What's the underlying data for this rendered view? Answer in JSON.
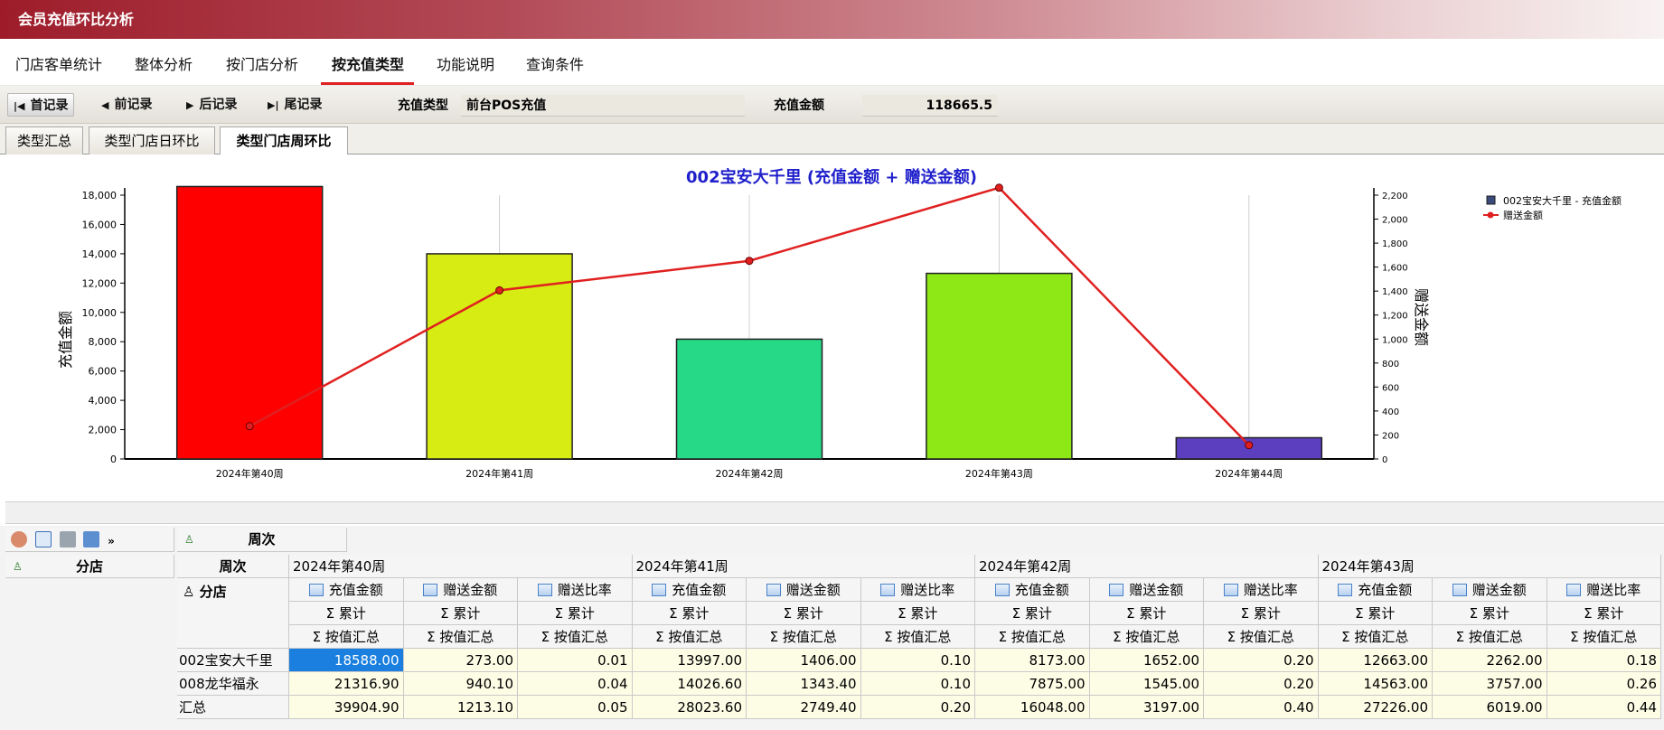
{
  "window": {
    "title": "会员充值环比分析"
  },
  "main_tabs": [
    {
      "label": "门店客单统计"
    },
    {
      "label": "整体分析"
    },
    {
      "label": "按门店分析"
    },
    {
      "label": "按充值类型",
      "active": true
    },
    {
      "label": "功能说明"
    },
    {
      "label": "查询条件"
    }
  ],
  "nav": {
    "first": "首记录",
    "prev": "前记录",
    "next": "后记录",
    "last": "尾记录"
  },
  "fields": {
    "recharge_type_label": "充值类型",
    "recharge_type_value": "前台POS充值",
    "recharge_amount_label": "充值金额",
    "recharge_amount_value": "118665.5"
  },
  "sub_tabs": [
    {
      "label": "类型汇总"
    },
    {
      "label": "类型门店日环比"
    },
    {
      "label": "类型门店周环比",
      "active": true
    }
  ],
  "chart_data": {
    "type": "bar+line",
    "title": "002宝安大千里 (充值金额 + 赠送金额)",
    "categories": [
      "2024年第40周",
      "2024年第41周",
      "2024年第42周",
      "2024年第43周",
      "2024年第44周"
    ],
    "series": [
      {
        "name": "002宝安大千里 - 充值金额",
        "type": "bar",
        "axis": "left",
        "values": [
          18588.0,
          13997.0,
          8173.0,
          12663.0,
          1450.0
        ],
        "colors": [
          "#ff0000",
          "#d6ec12",
          "#26d987",
          "#8de816",
          "#5b3fbf"
        ]
      },
      {
        "name": "赠送金额",
        "type": "line",
        "axis": "right",
        "color": "#e02020",
        "values": [
          273.0,
          1406.0,
          1652.0,
          2262.0,
          115.0
        ]
      }
    ],
    "ylabel": "充值金额",
    "y2label": "赠送金额",
    "ylim": [
      0,
      18000
    ],
    "y2lim": [
      0,
      2200
    ],
    "y_ticks": [
      "0",
      "2,000",
      "4,000",
      "6,000",
      "8,000",
      "10,000",
      "12,000",
      "14,000",
      "16,000",
      "18,000"
    ],
    "y2_ticks": [
      "0",
      "200",
      "400",
      "600",
      "800",
      "1,000",
      "1,200",
      "1,400",
      "1,600",
      "1,800",
      "2,000",
      "2,200"
    ],
    "legend_position": "top-right",
    "grid": "vertical"
  },
  "pivot": {
    "filter_field": "周次",
    "row_field": "分店",
    "col_field": "周次",
    "weeks": [
      "2024年第40周",
      "2024年第41周",
      "2024年第42周",
      "2024年第43周"
    ],
    "measures": [
      "充值金额",
      "赠送金额",
      "赠送比率"
    ],
    "agg1": "Σ 累计",
    "agg2": "Σ 按值汇总",
    "rows": [
      {
        "label": "002宝安大千里",
        "values": [
          "18588.00",
          "273.00",
          "0.01",
          "13997.00",
          "1406.00",
          "0.10",
          "8173.00",
          "1652.00",
          "0.20",
          "12663.00",
          "2262.00",
          "0.18"
        ]
      },
      {
        "label": "008龙华福永",
        "values": [
          "21316.90",
          "940.10",
          "0.04",
          "14026.60",
          "1343.40",
          "0.10",
          "7875.00",
          "1545.00",
          "0.20",
          "14563.00",
          "3757.00",
          "0.26"
        ]
      },
      {
        "label": "汇总",
        "values": [
          "39904.90",
          "1213.10",
          "0.05",
          "28023.60",
          "2749.40",
          "0.20",
          "16048.00",
          "3197.00",
          "0.40",
          "27226.00",
          "6019.00",
          "0.44"
        ]
      }
    ]
  }
}
